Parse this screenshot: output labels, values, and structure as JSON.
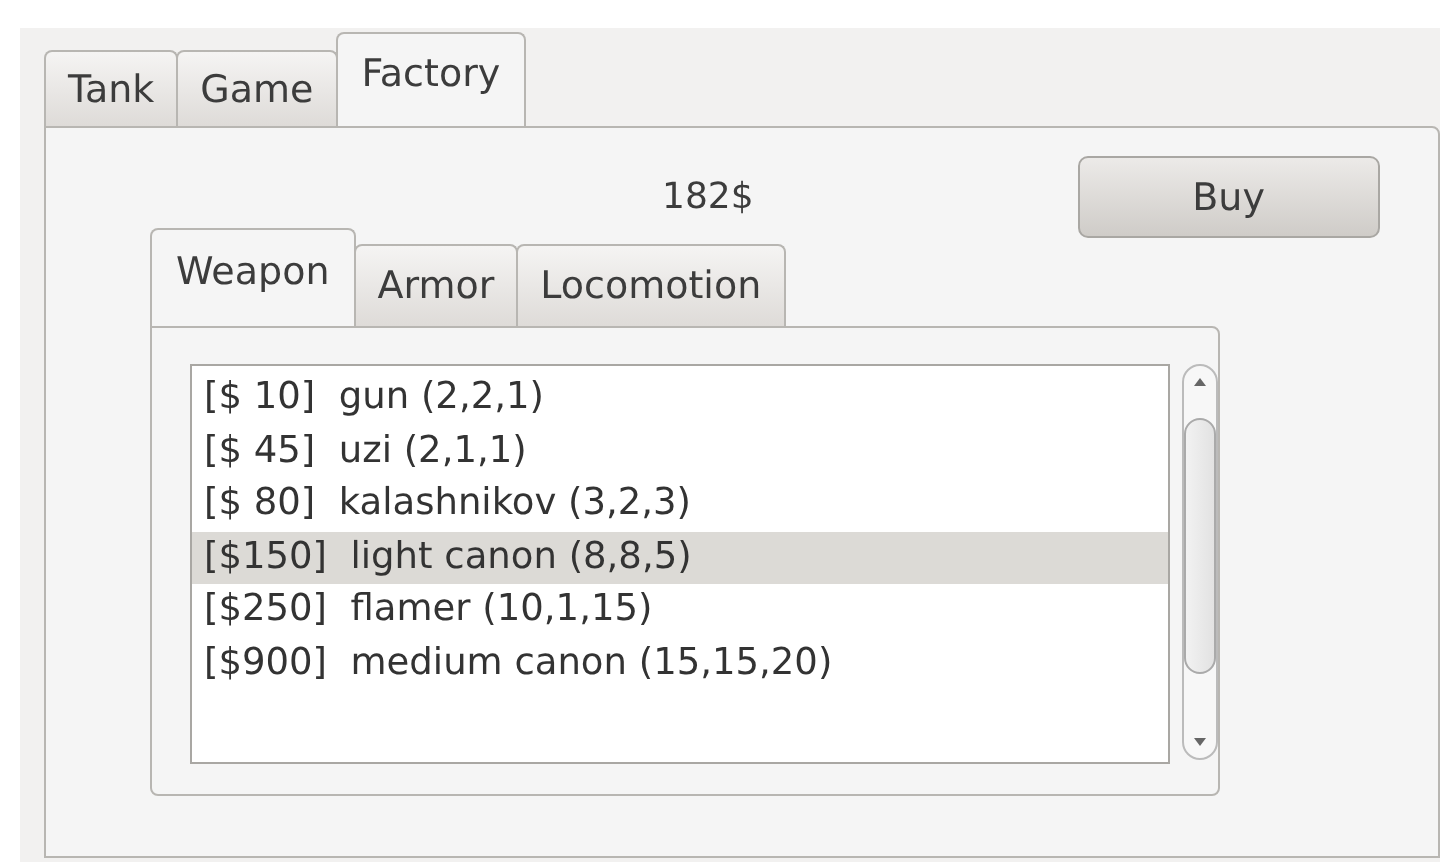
{
  "tabs": [
    {
      "label": "Tank",
      "selected": false
    },
    {
      "label": "Game",
      "selected": false
    },
    {
      "label": "Factory",
      "selected": true
    }
  ],
  "money": "182$",
  "buy_button": "Buy",
  "sub_tabs": [
    {
      "label": "Weapon",
      "selected": true
    },
    {
      "label": "Armor",
      "selected": false
    },
    {
      "label": "Locomotion",
      "selected": false
    }
  ],
  "items": [
    {
      "text": "[$ 10]  gun (2,2,1)",
      "selected": false
    },
    {
      "text": "[$ 45]  uzi (2,1,1)",
      "selected": false
    },
    {
      "text": "[$ 80]  kalashnikov (3,2,3)",
      "selected": false
    },
    {
      "text": "[$150]  light canon (8,8,5)",
      "selected": true
    },
    {
      "text": "[$250]  flamer (10,1,15)",
      "selected": false
    },
    {
      "text": "[$900]  medium canon (15,15,20)",
      "selected": false
    }
  ]
}
